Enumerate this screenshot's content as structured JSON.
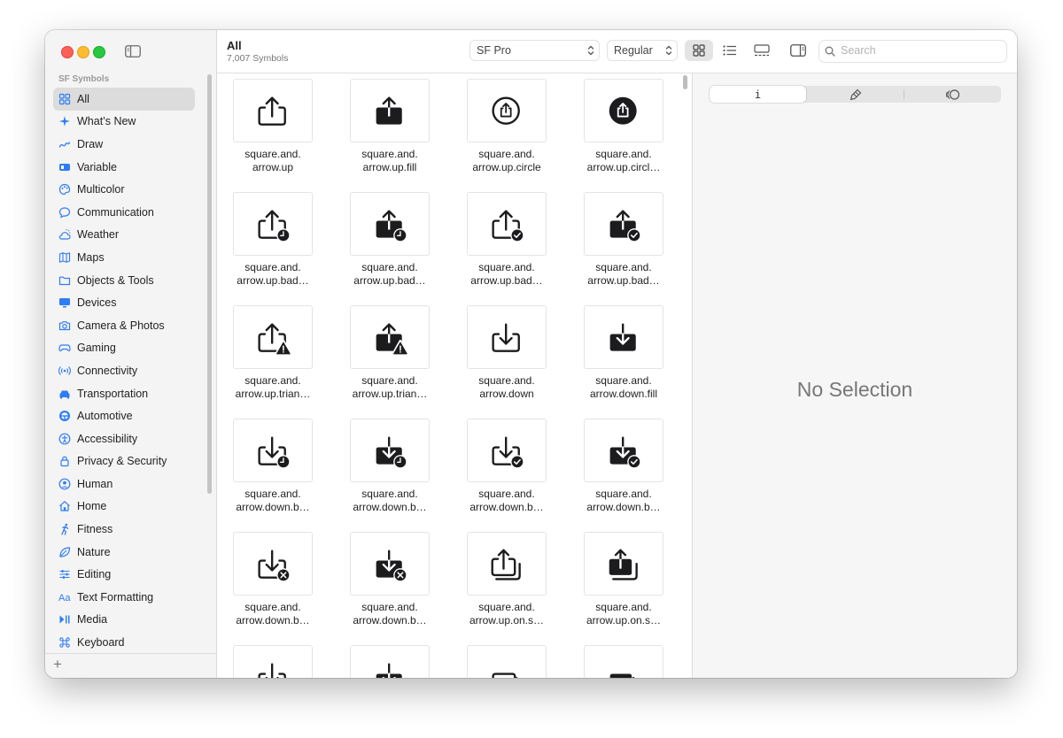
{
  "sidebar": {
    "header": "SF Symbols",
    "items": [
      {
        "label": "All",
        "icon": "grid-icon",
        "selected": true
      },
      {
        "label": "What’s New",
        "icon": "sparkle-icon"
      },
      {
        "label": "Draw",
        "icon": "scribble-icon"
      },
      {
        "label": "Variable",
        "icon": "variable-icon"
      },
      {
        "label": "Multicolor",
        "icon": "paintpalette-icon"
      },
      {
        "label": "Communication",
        "icon": "message-bubble-icon"
      },
      {
        "label": "Weather",
        "icon": "cloud-sun-icon"
      },
      {
        "label": "Maps",
        "icon": "map-icon"
      },
      {
        "label": "Objects & Tools",
        "icon": "folder-icon"
      },
      {
        "label": "Devices",
        "icon": "desktop-icon"
      },
      {
        "label": "Camera & Photos",
        "icon": "camera-icon"
      },
      {
        "label": "Gaming",
        "icon": "gamecontroller-icon"
      },
      {
        "label": "Connectivity",
        "icon": "antenna-icon"
      },
      {
        "label": "Transportation",
        "icon": "car-icon"
      },
      {
        "label": "Automotive",
        "icon": "steering-wheel-icon"
      },
      {
        "label": "Accessibility",
        "icon": "accessibility-icon"
      },
      {
        "label": "Privacy & Security",
        "icon": "lock-icon"
      },
      {
        "label": "Human",
        "icon": "person-circle-icon"
      },
      {
        "label": "Home",
        "icon": "house-icon"
      },
      {
        "label": "Fitness",
        "icon": "figure-run-icon"
      },
      {
        "label": "Nature",
        "icon": "leaf-icon"
      },
      {
        "label": "Editing",
        "icon": "sliders-icon"
      },
      {
        "label": "Text Formatting",
        "icon": "textformat-icon"
      },
      {
        "label": "Media",
        "icon": "playpause-icon"
      },
      {
        "label": "Keyboard",
        "icon": "command-icon"
      }
    ],
    "add_label": "+"
  },
  "toolbar": {
    "title": "All",
    "subtitle": "7,007 Symbols",
    "font_select": "SF Pro",
    "weight_select": "Regular",
    "search_placeholder": "Search"
  },
  "grid": {
    "items": [
      {
        "line1": "square.and.",
        "line2": "arrow.up",
        "kind": "up",
        "fill": false,
        "badge": "none"
      },
      {
        "line1": "square.and.",
        "line2": "arrow.up.fill",
        "kind": "up",
        "fill": true,
        "badge": "none"
      },
      {
        "line1": "square.and.",
        "line2": "arrow.up.circle",
        "kind": "circle",
        "fill": false,
        "badge": "none"
      },
      {
        "line1": "square.and.",
        "line2": "arrow.up.circl…",
        "kind": "circle",
        "fill": true,
        "badge": "none"
      },
      {
        "line1": "square.and.",
        "line2": "arrow.up.bad…",
        "kind": "up",
        "fill": false,
        "badge": "clock"
      },
      {
        "line1": "square.and.",
        "line2": "arrow.up.bad…",
        "kind": "up",
        "fill": true,
        "badge": "clock"
      },
      {
        "line1": "square.and.",
        "line2": "arrow.up.bad…",
        "kind": "up",
        "fill": false,
        "badge": "check"
      },
      {
        "line1": "square.and.",
        "line2": "arrow.up.bad…",
        "kind": "up",
        "fill": true,
        "badge": "check"
      },
      {
        "line1": "square.and.",
        "line2": "arrow.up.trian…",
        "kind": "up",
        "fill": false,
        "badge": "warn"
      },
      {
        "line1": "square.and.",
        "line2": "arrow.up.trian…",
        "kind": "up",
        "fill": true,
        "badge": "warn"
      },
      {
        "line1": "square.and.",
        "line2": "arrow.down",
        "kind": "down",
        "fill": false,
        "badge": "none"
      },
      {
        "line1": "square.and.",
        "line2": "arrow.down.fill",
        "kind": "down",
        "fill": true,
        "badge": "none"
      },
      {
        "line1": "square.and.",
        "line2": "arrow.down.b…",
        "kind": "down",
        "fill": false,
        "badge": "clock"
      },
      {
        "line1": "square.and.",
        "line2": "arrow.down.b…",
        "kind": "down",
        "fill": true,
        "badge": "clock"
      },
      {
        "line1": "square.and.",
        "line2": "arrow.down.b…",
        "kind": "down",
        "fill": false,
        "badge": "check"
      },
      {
        "line1": "square.and.",
        "line2": "arrow.down.b…",
        "kind": "down",
        "fill": true,
        "badge": "check"
      },
      {
        "line1": "square.and.",
        "line2": "arrow.down.b…",
        "kind": "down",
        "fill": false,
        "badge": "x"
      },
      {
        "line1": "square.and.",
        "line2": "arrow.down.b…",
        "kind": "down",
        "fill": true,
        "badge": "x"
      },
      {
        "line1": "square.and.",
        "line2": "arrow.up.on.s…",
        "kind": "stack",
        "fill": false,
        "badge": "none"
      },
      {
        "line1": "square.and.",
        "line2": "arrow.up.on.s…",
        "kind": "stack",
        "fill": true,
        "badge": "none"
      },
      {
        "line1": "",
        "line2": "",
        "kind": "down",
        "fill": false,
        "badge": "stack"
      },
      {
        "line1": "",
        "line2": "",
        "kind": "down",
        "fill": true,
        "badge": "stack"
      },
      {
        "line1": "",
        "line2": "",
        "kind": "fwd",
        "fill": false,
        "badge": "none"
      },
      {
        "line1": "",
        "line2": "",
        "kind": "fwd",
        "fill": true,
        "badge": "none"
      }
    ]
  },
  "inspector": {
    "tabs": [
      {
        "icon": "info-icon",
        "glyph": "i",
        "active": true
      },
      {
        "icon": "paintbrush-icon",
        "glyph": "",
        "active": false
      },
      {
        "icon": "animation-icon",
        "glyph": "",
        "active": false
      }
    ],
    "empty_text": "No Selection"
  }
}
